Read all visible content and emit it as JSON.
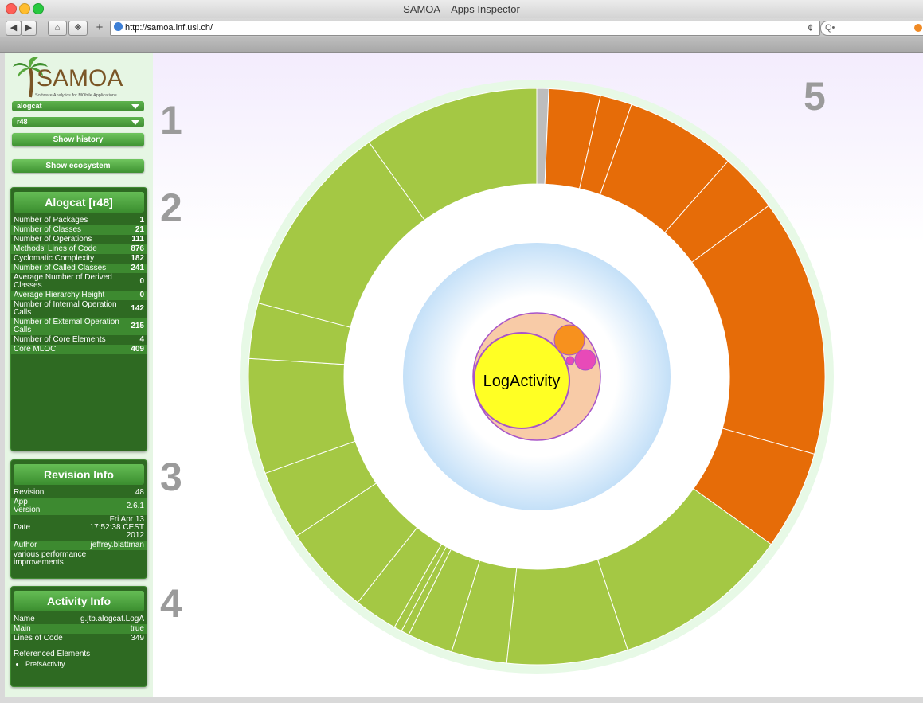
{
  "window": {
    "title": "SAMOA – Apps Inspector",
    "url": "http://samoa.inf.usi.ch/",
    "search_placeholder": "Q•",
    "reload_icon": "¢",
    "add_icon": "+"
  },
  "logo": {
    "text": "SAMOA",
    "tagline": "Software Analytics for MObile Applications"
  },
  "controls": {
    "app_select": "alogcat",
    "revision_select": "r48",
    "show_history": "Show history",
    "show_ecosystem": "Show ecosystem"
  },
  "app_panel": {
    "title": "Alogcat [r48]",
    "rows": [
      {
        "label": "Number of Packages",
        "value": "1"
      },
      {
        "label": "Number of Classes",
        "value": "21"
      },
      {
        "label": "Number of Operations",
        "value": "111"
      },
      {
        "label": "Methods' Lines of Code",
        "value": "876"
      },
      {
        "label": "Cyclomatic Complexity",
        "value": "182"
      },
      {
        "label": "Number of Called Classes",
        "value": "241"
      },
      {
        "label": "Average Number of Derived Classes",
        "value": "0"
      },
      {
        "label": "Average Hierarchy Height",
        "value": "0"
      },
      {
        "label": "Number of Internal Operation Calls",
        "value": "142"
      },
      {
        "label": "Number of External Operation Calls",
        "value": "215"
      },
      {
        "label": "Number of Core Elements",
        "value": "4"
      },
      {
        "label": "Core MLOC",
        "value": "409"
      }
    ]
  },
  "revision_panel": {
    "title": "Revision Info",
    "revision_label": "Revision",
    "revision_value": "48",
    "version_label": "App Version",
    "version_value": "2.6.1",
    "date_label": "Date",
    "date_value": "Fri Apr 13 17:52:38 CEST 2012",
    "author_label": "Author",
    "author_value": "jeffrey.blattman",
    "message": "various performance improvements"
  },
  "activity_panel": {
    "title": "Activity Info",
    "name_label": "Name",
    "name_value": "g.jtb.alogcat.LogA",
    "main_label": "Main",
    "main_value": "true",
    "loc_label": "Lines of Code",
    "loc_value": "349",
    "referenced_label": "Referenced Elements",
    "referenced": [
      "PrefsActivity"
    ]
  },
  "section_numbers": [
    "1",
    "2",
    "3",
    "4",
    "5"
  ],
  "visualization": {
    "center_label": "LogActivity",
    "colors": {
      "core": "#a4c844",
      "external": "#e66c08",
      "separator": "#bdbdbd",
      "ring_background": "#e7f9e6",
      "center_yellow": "#ffff24",
      "class_peach": "#f8cba7",
      "outline_purple": "#a855c8",
      "orange_bubble": "#f7911e",
      "magenta_bubble": "#e84ab8",
      "sky_blue": "#c4e0f8"
    },
    "donut_segments": [
      {
        "group": "separator",
        "share": 0.006
      },
      {
        "group": "external",
        "share": 0.026
      },
      {
        "group": "external",
        "share": 0.016
      },
      {
        "group": "external",
        "share": 0.056
      },
      {
        "group": "external",
        "share": 0.03
      },
      {
        "group": "external",
        "share": 0.13
      },
      {
        "group": "external",
        "share": 0.05
      },
      {
        "group": "core",
        "share": 0.09
      },
      {
        "group": "core",
        "share": 0.061
      },
      {
        "group": "core",
        "share": 0.028
      },
      {
        "group": "core",
        "share": 0.023
      },
      {
        "group": "core",
        "share": 0.004
      },
      {
        "group": "core",
        "share": 0.004
      },
      {
        "group": "core",
        "share": 0.022
      },
      {
        "group": "core",
        "share": 0.045
      },
      {
        "group": "core",
        "share": 0.035
      },
      {
        "group": "core",
        "share": 0.058
      },
      {
        "group": "core",
        "share": 0.028
      },
      {
        "group": "core",
        "share": 0.099
      },
      {
        "group": "core",
        "share": 0.089
      }
    ]
  }
}
